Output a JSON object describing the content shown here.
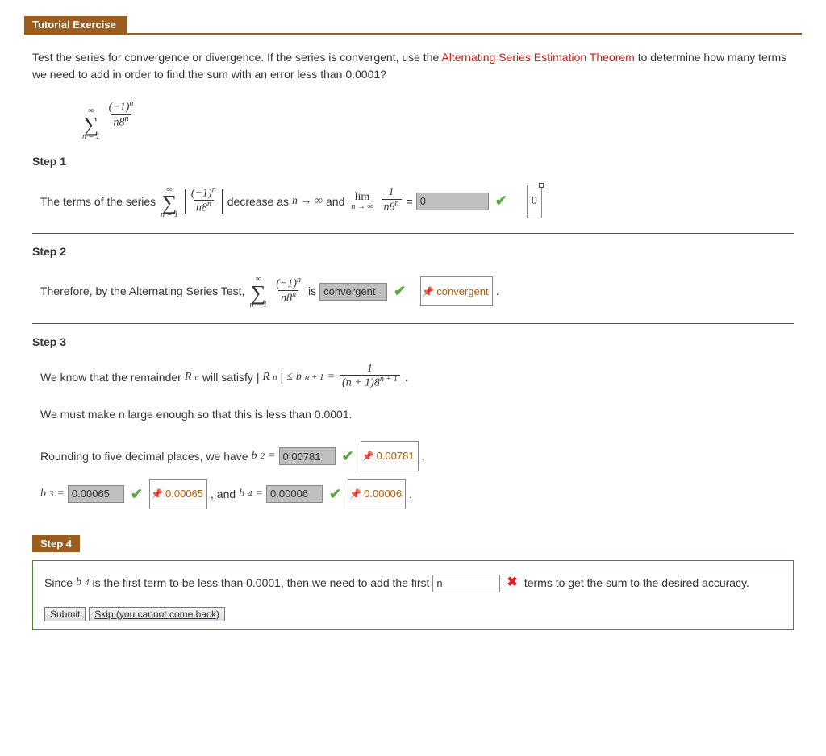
{
  "header": {
    "title": "Tutorial Exercise"
  },
  "prompt": {
    "p1a": "Test the series for convergence or divergence. If the series is convergent, use the ",
    "p1b": "Alternating Series Estimation Theorem",
    "p1c": " to determine how many terms we need to add in order to find the sum with an error less than 0.0001?"
  },
  "step1": {
    "label": "Step 1",
    "t1": "The terms of the series ",
    "t2": " decrease as ",
    "t3": " and ",
    "eq": " = ",
    "ans": "0",
    "tip": "0"
  },
  "step2": {
    "label": "Step 2",
    "t1": "Therefore, by the Alternating Series Test, ",
    "t2": " is ",
    "ans": "convergent",
    "tip": "convergent",
    "dot": " ."
  },
  "step3": {
    "label": "Step 3",
    "l1a": "We know that the remainder ",
    "l1b": " will satisfy ",
    "l2": "We must make n large enough so that this is less than 0.0001.",
    "l3": "Rounding to five decimal places, we have ",
    "b2": "0.00781",
    "b3": "0.00065",
    "b4": "0.00006",
    "and": " , and ",
    "comma": " , ",
    "dot": " ."
  },
  "step4": {
    "label": "Step 4",
    "t1": "Since ",
    "t2": " is the first term to be less than 0.0001, then we need to add the first ",
    "ans": "n",
    "t3": "terms to get the sum to the desired accuracy.",
    "submit": "Submit",
    "skip": "Skip (you cannot come back)"
  },
  "math": {
    "inf": "∞",
    "n1": "n = 1",
    "numA": "(−1)",
    "supn": "n",
    "denA": "n8",
    "lim": "lim",
    "ninf": "n → ∞",
    "one": "1",
    "Rn": "R",
    "bnp1": "b",
    "np1": "n + 1",
    "denR": "(n + 1)8",
    "b2": "b",
    "s2": "2",
    "b3": "b",
    "s3": "3",
    "b4": "b",
    "s4": "4",
    "eq": " = ",
    "le": " ≤ ",
    "arrow": "n → ∞"
  }
}
